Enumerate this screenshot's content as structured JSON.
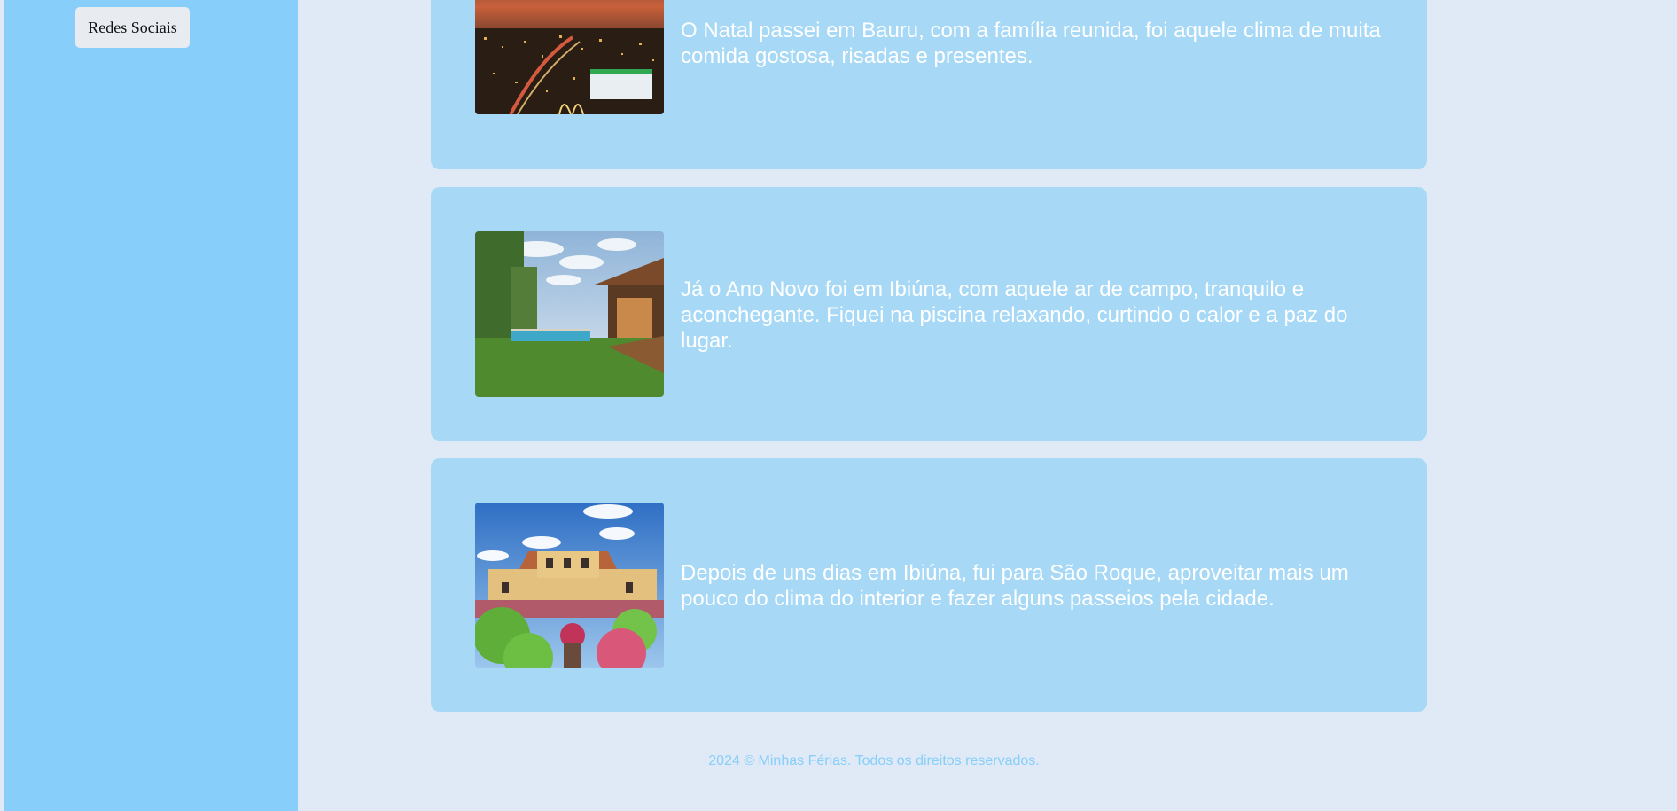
{
  "sidebar": {
    "social_button_label": "Redes Sociais"
  },
  "posts": [
    {
      "image_name": "bauru-night-city-photo",
      "text": "O Natal passei em Bauru, com a família reunida, foi aquele clima de muita comida gostosa, risadas e presentes."
    },
    {
      "image_name": "ibiuna-pool-house-photo",
      "text": "Já o Ano Novo foi em Ibiúna, com aquele ar de campo, tranquilo e aconchegante. Fiquei na piscina relaxando, curtindo o calor e a paz do lugar."
    },
    {
      "image_name": "sao-roque-mansion-garden-photo",
      "text": "Depois de uns dias em Ibiúna, fui para São Roque, aproveitar mais um pouco do clima do interior e fazer alguns passeios pela cidade."
    }
  ],
  "footer": {
    "text": "2024 © Minhas Férias. Todos os direitos reservados."
  },
  "colors": {
    "page_background": "#dfeaf6",
    "sidebar": "#87cefa",
    "card": "#a7d9f6",
    "footer_text": "#87cefa"
  }
}
